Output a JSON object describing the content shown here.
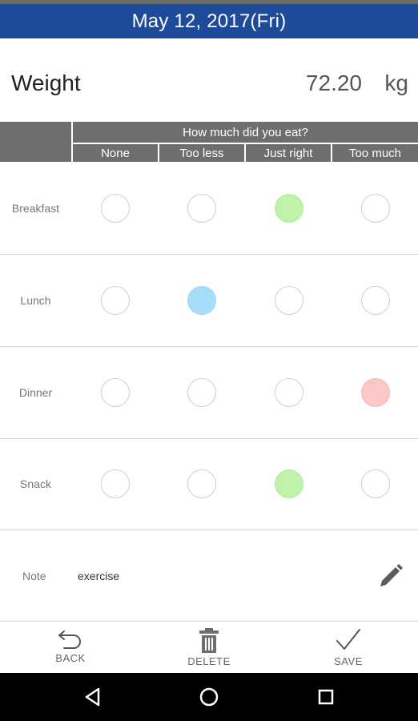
{
  "header": {
    "date": "May 12, 2017(Fri)"
  },
  "weight": {
    "label": "Weight",
    "value": "72.20",
    "unit": "kg"
  },
  "grid": {
    "question": "How much did you eat?",
    "columns": [
      "None",
      "Too less",
      "Just right",
      "Too much"
    ]
  },
  "meals": [
    {
      "label": "Breakfast",
      "selected_index": 2,
      "selected_color": "#bff3aa"
    },
    {
      "label": "Lunch",
      "selected_index": 1,
      "selected_color": "#a8dcfb"
    },
    {
      "label": "Dinner",
      "selected_index": 3,
      "selected_color": "#fbc7c7"
    },
    {
      "label": "Snack",
      "selected_index": 2,
      "selected_color": "#bff3aa"
    }
  ],
  "note": {
    "label": "Note",
    "text": "exercise",
    "edit_icon": "pencil-icon"
  },
  "footer": {
    "back_label": "BACK",
    "delete_label": "DELETE",
    "save_label": "SAVE"
  },
  "colors": {
    "header_bg": "#1d4b9a",
    "grid_header_bg": "#6e6e6e"
  },
  "navbar": {
    "icons": [
      "back-triangle-icon",
      "home-circle-icon",
      "recents-square-icon"
    ]
  }
}
